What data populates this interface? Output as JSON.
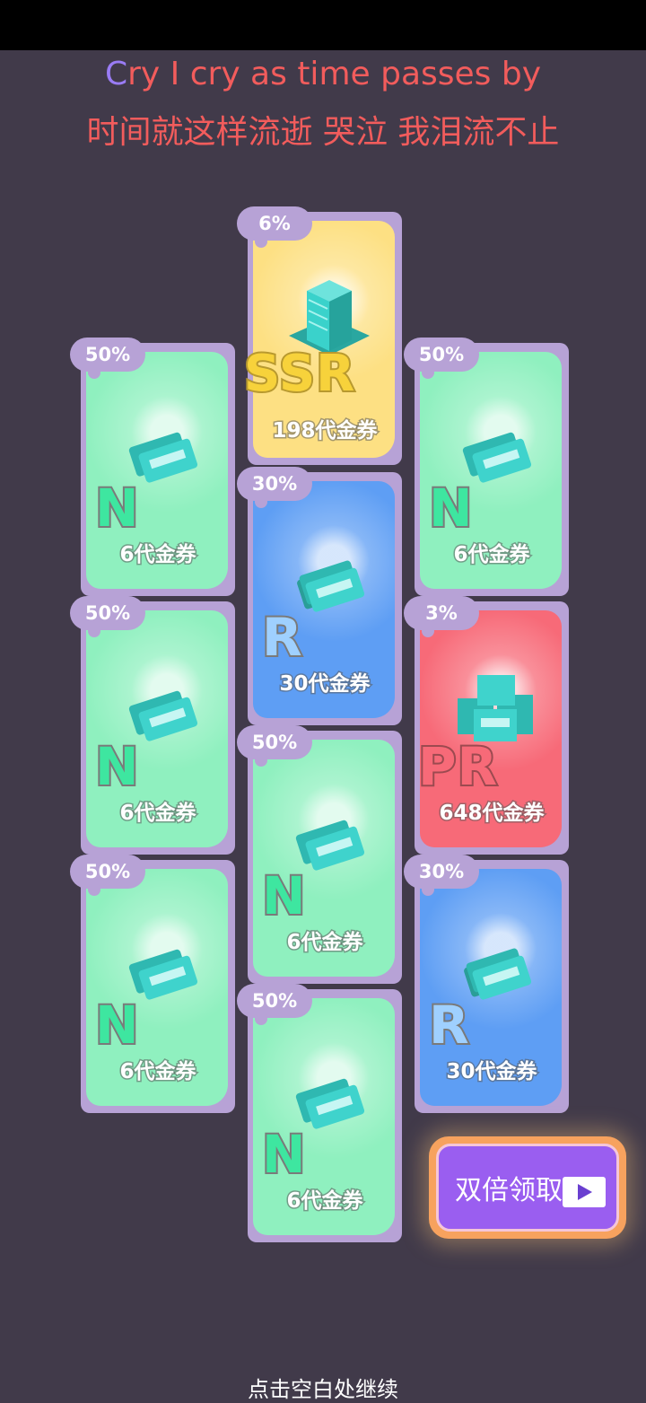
{
  "lyrics": {
    "line1_first": "C",
    "line1_rest": "ry I cry as time passes by",
    "line2": "时间就这样流逝 哭泣 我泪流不止"
  },
  "colors": {
    "background": "#413a4a",
    "card_frame": "#b7a2d6",
    "rarity_n": "#8ff0bf",
    "rarity_r": "#5e9ef4",
    "rarity_ssr": "#fde083",
    "rarity_pr": "#f76a78",
    "lyric": "#f25c5c",
    "double_button": "#9a5ef0"
  },
  "cards": [
    {
      "id": "card-1",
      "chance": "6%",
      "rank": "SSR",
      "reward": "198代金券",
      "icon": "voucher-stack-icon"
    },
    {
      "id": "card-2",
      "chance": "50%",
      "rank": "N",
      "reward": "6代金券",
      "icon": "voucher-icon"
    },
    {
      "id": "card-3",
      "chance": "50%",
      "rank": "N",
      "reward": "6代金券",
      "icon": "voucher-icon"
    },
    {
      "id": "card-4",
      "chance": "30%",
      "rank": "R",
      "reward": "30代金券",
      "icon": "voucher-icon"
    },
    {
      "id": "card-5",
      "chance": "50%",
      "rank": "N",
      "reward": "6代金券",
      "icon": "voucher-icon"
    },
    {
      "id": "card-6",
      "chance": "3%",
      "rank": "PR",
      "reward": "648代金券",
      "icon": "voucher-pile-icon"
    },
    {
      "id": "card-7",
      "chance": "50%",
      "rank": "N",
      "reward": "6代金券",
      "icon": "voucher-icon"
    },
    {
      "id": "card-8",
      "chance": "50%",
      "rank": "N",
      "reward": "6代金券",
      "icon": "voucher-icon"
    },
    {
      "id": "card-9",
      "chance": "30%",
      "rank": "R",
      "reward": "30代金券",
      "icon": "voucher-icon"
    },
    {
      "id": "card-10",
      "chance": "50%",
      "rank": "N",
      "reward": "6代金券",
      "icon": "voucher-icon"
    }
  ],
  "double_claim": {
    "label": "双倍领取",
    "icon": "video-play-icon"
  },
  "continue_hint": "点击空白处继续"
}
